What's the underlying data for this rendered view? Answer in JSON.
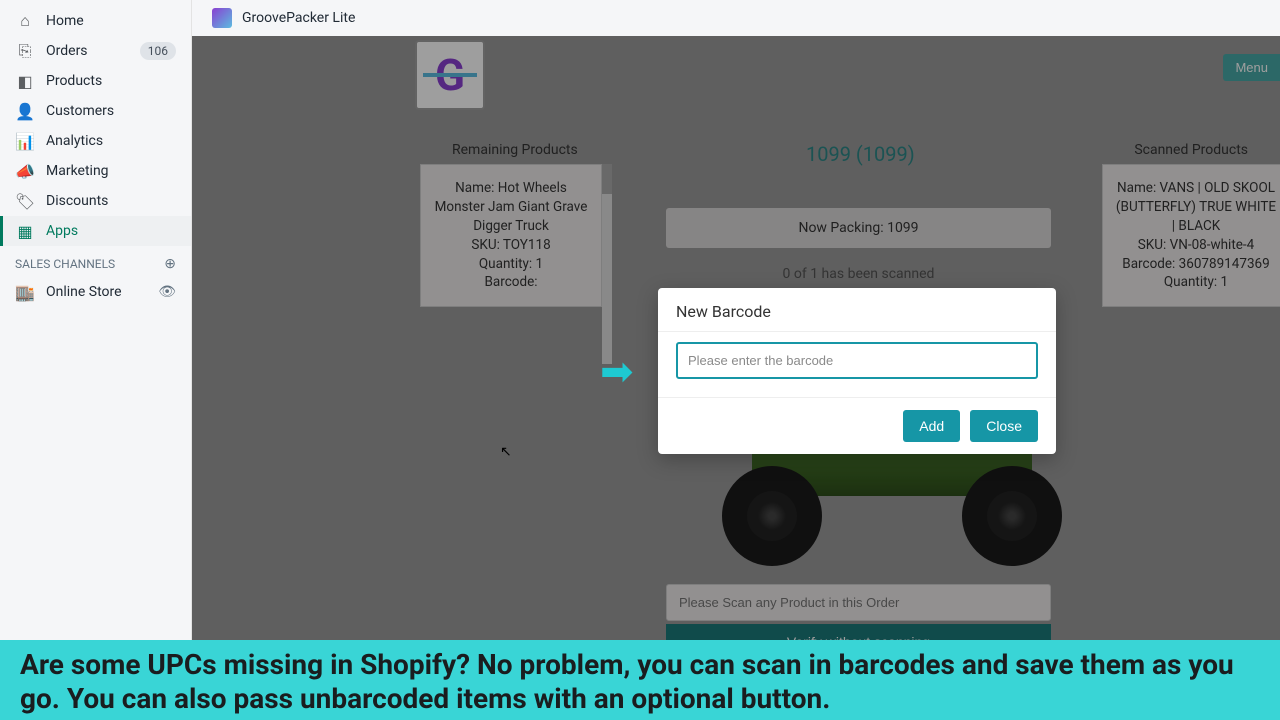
{
  "sidebar": {
    "items": [
      {
        "label": "Home",
        "icon": "home-icon"
      },
      {
        "label": "Orders",
        "icon": "orders-icon",
        "badge": "106"
      },
      {
        "label": "Products",
        "icon": "products-icon"
      },
      {
        "label": "Customers",
        "icon": "customers-icon"
      },
      {
        "label": "Analytics",
        "icon": "analytics-icon"
      },
      {
        "label": "Marketing",
        "icon": "marketing-icon"
      },
      {
        "label": "Discounts",
        "icon": "discounts-icon"
      },
      {
        "label": "Apps",
        "icon": "apps-icon",
        "active": true
      }
    ],
    "section_label": "SALES CHANNELS",
    "channel": "Online Store"
  },
  "topbar": {
    "app_title": "GroovePacker Lite"
  },
  "main": {
    "menu_label": "Menu",
    "remaining_header": "Remaining Products",
    "scanned_header": "Scanned Products",
    "order_number": "1099 (1099)",
    "now_packing": "Now Packing: 1099",
    "scan_status": "0 of 1 has been scanned",
    "remaining": {
      "name_label": "Name: Hot Wheels Monster Jam Giant Grave Digger Truck",
      "sku": "SKU: TOY118",
      "quantity": "Quantity: 1",
      "barcode": "Barcode:"
    },
    "scanned": {
      "name_label": "Name: VANS | OLD SKOOL (BUTTERFLY) TRUE WHITE | BLACK",
      "sku": "SKU: VN-08-white-4",
      "barcode": "Barcode: 360789147369",
      "quantity": "Quantity: 1"
    },
    "scan_placeholder": "Please Scan any Product in this Order",
    "verify_label": "Verify without scanning"
  },
  "modal": {
    "title": "New Barcode",
    "placeholder": "Please enter the barcode",
    "add_label": "Add",
    "close_label": "Close"
  },
  "footer": "Are some UPCs missing in Shopify? No problem, you can scan in barcodes and save them as you go. You can also pass unbarcoded items with an optional button."
}
